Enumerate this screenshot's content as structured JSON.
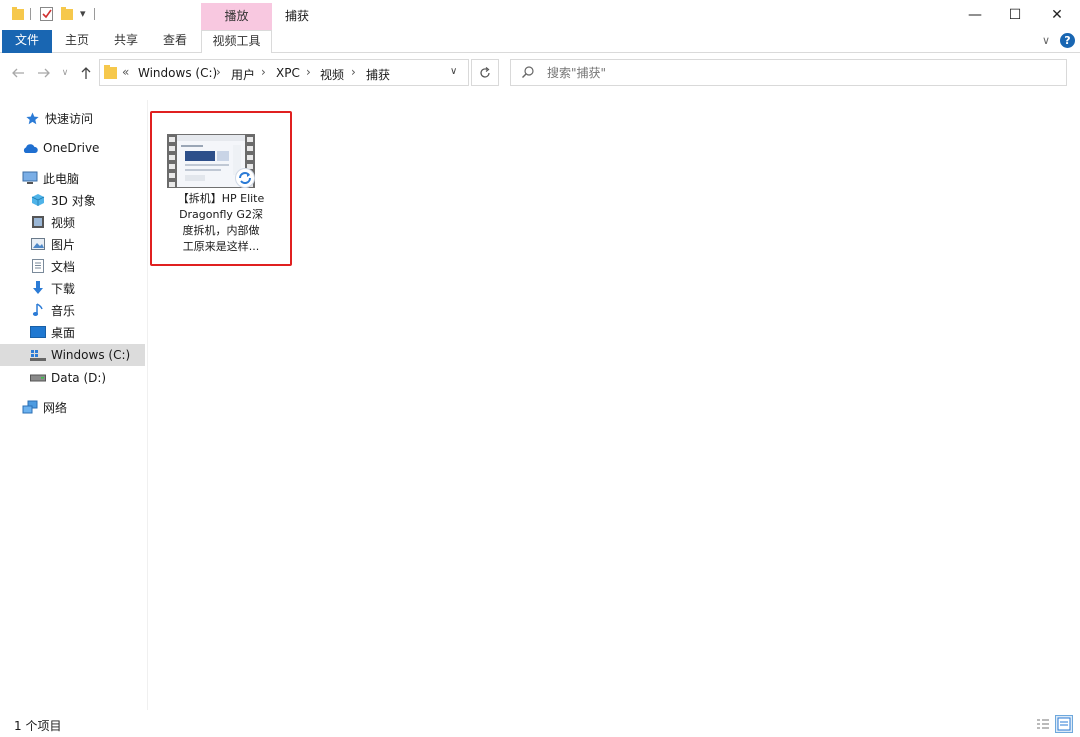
{
  "window": {
    "title": "捕获",
    "context_tab_header": "播放",
    "controls": {
      "minimize": "—",
      "maximize": "☐",
      "close": "✕"
    }
  },
  "ribbon": {
    "tabs": [
      {
        "label": "文件",
        "active": true
      },
      {
        "label": "主页"
      },
      {
        "label": "共享"
      },
      {
        "label": "查看"
      },
      {
        "label": "视频工具"
      }
    ]
  },
  "address_bar": {
    "overflow": "«",
    "breadcrumbs": [
      "Windows (C:)",
      "用户",
      "XPC",
      "视频",
      "捕获"
    ]
  },
  "search": {
    "placeholder": "搜索\"捕获\""
  },
  "nav_pane": {
    "items": [
      {
        "label": "快速访问",
        "icon": "star-icon",
        "level": 0
      },
      {
        "label": "OneDrive",
        "icon": "cloud-icon",
        "level": 0
      },
      {
        "label": "此电脑",
        "icon": "computer-icon",
        "level": 0
      },
      {
        "label": "3D 对象",
        "icon": "cube-icon",
        "level": 1
      },
      {
        "label": "视频",
        "icon": "video-icon",
        "level": 1
      },
      {
        "label": "图片",
        "icon": "picture-icon",
        "level": 1
      },
      {
        "label": "文档",
        "icon": "document-icon",
        "level": 1
      },
      {
        "label": "下载",
        "icon": "download-icon",
        "level": 1
      },
      {
        "label": "音乐",
        "icon": "music-icon",
        "level": 1
      },
      {
        "label": "桌面",
        "icon": "desktop-icon",
        "level": 1
      },
      {
        "label": "Windows (C:)",
        "icon": "windows-drive-icon",
        "level": 1,
        "selected": true
      },
      {
        "label": "Data (D:)",
        "icon": "drive-icon",
        "level": 1
      },
      {
        "label": "网络",
        "icon": "network-icon",
        "level": 0
      }
    ]
  },
  "files": [
    {
      "name_lines": [
        "【拆机】HP Elite",
        "Dragonfly G2深",
        "度拆机，内部做",
        "工原来是这样..."
      ],
      "type_icon": "video-file-thumbnail",
      "sync_badge": "sync-icon"
    }
  ],
  "status": {
    "item_count": "1 个项目"
  },
  "colors": {
    "accent": "#1966b2",
    "context_tab": "#f8c8e0",
    "selection_outline": "#e02020",
    "selected_nav": "#dcdcdc"
  }
}
